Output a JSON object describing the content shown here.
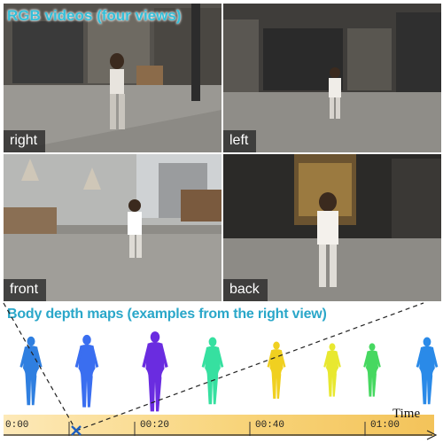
{
  "rgb_title": "RGB videos (four views)",
  "views": {
    "right": "right",
    "left": "left",
    "front": "front",
    "back": "back"
  },
  "depth_title": "Body depth maps  (examples from the right view)",
  "timeline": {
    "ticks": [
      "0:00",
      "00:20",
      "00:40",
      "01:00"
    ],
    "axis_label": "Time"
  },
  "colors": {
    "title_cyan": "#33bfd9",
    "depth_near": "#7a1fd6",
    "depth_far": "#f2e81a",
    "marker": "#1f5fbf"
  },
  "depth_figures_colors": [
    "#2f7fe0",
    "#3a6ef0",
    "#6a2ce0",
    "#36e0a0",
    "#f0d020",
    "#e8e830",
    "#46d860",
    "#2a8ae8"
  ]
}
